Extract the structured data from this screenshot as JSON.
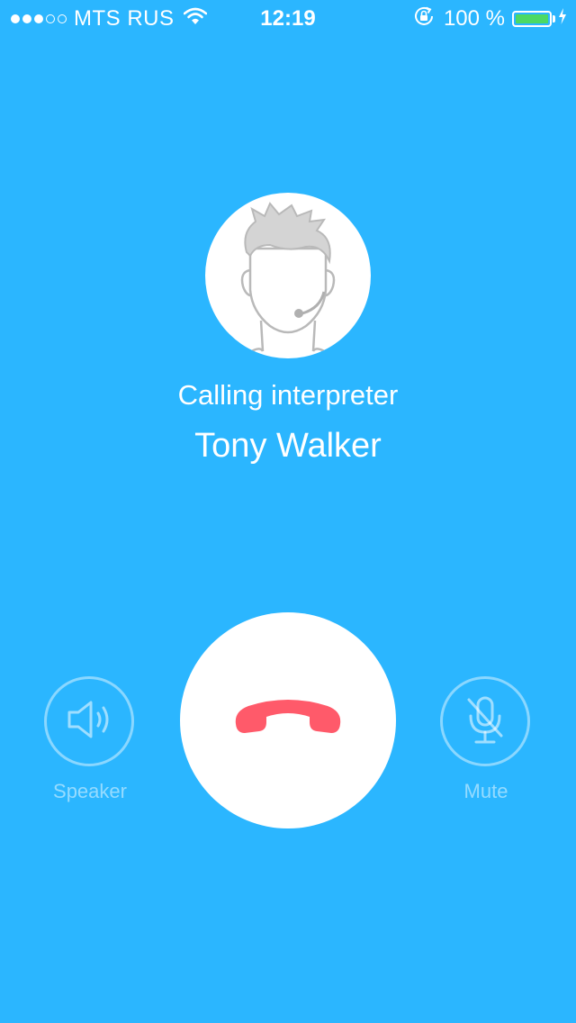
{
  "status_bar": {
    "signal_strength": "3 of 5",
    "carrier": "MTS RUS",
    "time": "12:19",
    "battery_percent": "100 %",
    "battery_level": 1.0,
    "icons": [
      "signal-dots-icon",
      "wifi-icon",
      "rotation-lock-icon",
      "battery-icon",
      "charging-icon"
    ]
  },
  "call": {
    "status_text": "Calling interpreter",
    "contact_name": "Tony Walker",
    "avatar_icon": "interpreter-avatar-icon"
  },
  "controls": {
    "speaker_label": "Speaker",
    "mute_label": "Mute",
    "hangup_icon": "hang-up-icon"
  },
  "colors": {
    "background": "#2bb6ff",
    "hangup": "#ff5a6a",
    "battery": "#4cd964"
  }
}
